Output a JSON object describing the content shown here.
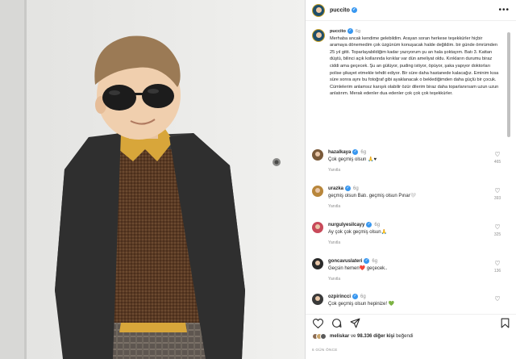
{
  "post": {
    "author": "puccito",
    "time": "6g",
    "caption": "Merhaba ancak kendime gelebildim. Arayan soran herkese teşekkürler hiçbir aramaya dönemedim çok üzgünüm konuşacak halde değildim. bir günde ömrümden 25 yıl gitti. Toparlayabildiğim kadar yazıyorum şu an hala şoktayım. Batı 3. Kattan düştü, bilinci açık kollarında kırıklar var dün ameliyat oldu. Kırıkların durumu biraz ciddi ama geçecek. Şu an gülüyor, puding istiyor, öpüyor, şaka yapıyor doktorları polise şikayet etmekle tehdit ediyor. Bir süre daha hastanede kalacağız. Eminim kısa süre sonra aynı bu fotoğraf gibi ayaklanacak o beklediğimden daha güçlü bir çocuk. Cümlelerim anlamsız karışık olabilir özür dilerim biraz daha toparlanırsam uzun uzun anlatırım. Merak edenler dua edenler çok çok çok teşekkürler."
  },
  "comments": [
    {
      "user": "hazalkaya",
      "time": "6g",
      "text": "Çok geçmiş olsun 🙏♥",
      "reply": "Yanıtla",
      "likes": "465",
      "color": "#7a5a3a"
    },
    {
      "user": "urazka",
      "time": "6g",
      "text": "geçmiş olsun Batı. geçmiş olsun Pınar🤍",
      "reply": "Yanıtla",
      "likes": "393",
      "color": "#b8863b"
    },
    {
      "user": "nurgulyesilcayy",
      "time": "6g",
      "text": "Ay çok çok geçmiş olsun🙏",
      "reply": "Yanıtla",
      "likes": "325",
      "color": "#c84a5a"
    },
    {
      "user": "goncavuslateri",
      "time": "6g",
      "text": "Geçsin hemen❤️ geçecek..",
      "reply": "Yanıtla",
      "likes": "136",
      "color": "#2a2a2a"
    },
    {
      "user": "ozpirincci",
      "time": "6g",
      "text": "Çok geçmiş olsun hepinize! 💚",
      "reply": "",
      "likes": "",
      "color": "#3a3a3a"
    }
  ],
  "likes_bar": {
    "first_liker": "meliskar",
    "connector": "ve",
    "count": "98.336 diğer kişi",
    "suffix": "beğendi"
  },
  "date": "6 GÜN ÖNCE",
  "icons": {
    "menu": "more-dots-icon",
    "like": "heart-icon",
    "comment": "comment-icon",
    "share": "share-icon",
    "save": "bookmark-icon",
    "verified": "verified-badge-icon"
  },
  "colors": {
    "verified": "#3897f0",
    "muted": "#8e8e8e",
    "text": "#262626"
  }
}
